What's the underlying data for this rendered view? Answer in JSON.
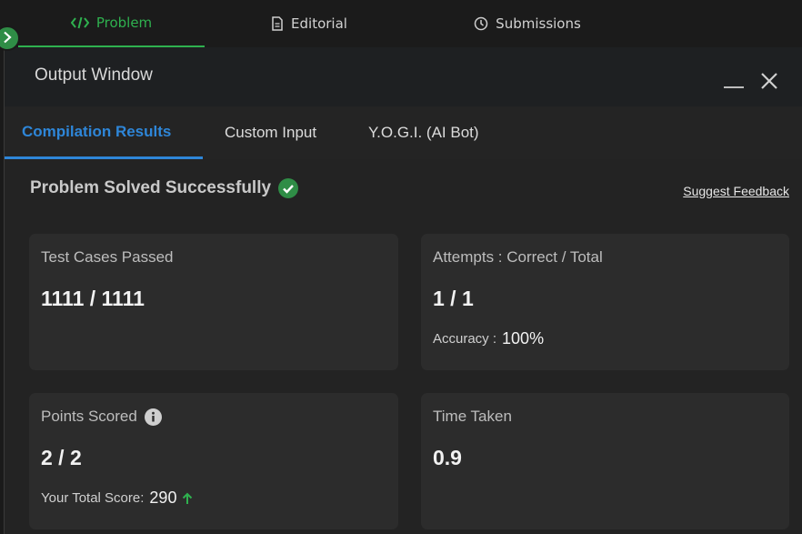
{
  "top_tabs": [
    {
      "label": "Problem",
      "icon": "code-icon",
      "active": true
    },
    {
      "label": "Editorial",
      "icon": "document-icon",
      "active": false
    },
    {
      "label": "Submissions",
      "icon": "clock-icon",
      "active": false
    }
  ],
  "output_window": {
    "title": "Output Window",
    "tabs": [
      {
        "label": "Compilation Results",
        "active": true
      },
      {
        "label": "Custom Input",
        "active": false
      },
      {
        "label": "Y.O.G.I. (AI Bot)",
        "active": false
      }
    ],
    "status": "Problem Solved Successfully",
    "feedback_link": "Suggest Feedback",
    "cards": {
      "tests": {
        "label": "Test Cases Passed",
        "value": "1111 / 1111"
      },
      "attempts": {
        "label": "Attempts : Correct / Total",
        "value": "1 / 1",
        "sub_label": "Accuracy :",
        "sub_value": "100%"
      },
      "points": {
        "label": "Points Scored",
        "value": "2 / 2",
        "sub_label": "Your Total Score:",
        "sub_value": "290"
      },
      "time": {
        "label": "Time Taken",
        "value": "0.9"
      }
    }
  },
  "colors": {
    "accent_green": "#2fb14f",
    "accent_blue": "#2e86d8",
    "success_green": "#2f8d46"
  }
}
